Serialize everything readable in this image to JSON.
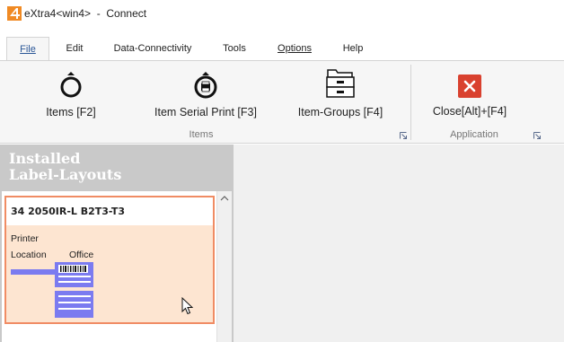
{
  "window": {
    "title": "eXtra4<win4>  -  Connect"
  },
  "menu": {
    "tabs": [
      {
        "label": "File",
        "active": true
      },
      {
        "label": "Edit",
        "active": false
      },
      {
        "label": "Data-Connectivity",
        "active": false
      },
      {
        "label": "Tools",
        "active": false
      },
      {
        "label": "Options",
        "active": false
      },
      {
        "label": "Help",
        "active": false
      }
    ]
  },
  "ribbon": {
    "buttons": [
      {
        "label": "Items [F2]",
        "icon": "ring-icon"
      },
      {
        "label": "Item Serial Print [F3]",
        "icon": "printer-ring-icon"
      },
      {
        "label": "Item-Groups [F4]",
        "icon": "folder-cabinet-icon"
      },
      {
        "label": "Close[Alt]+[F4]",
        "icon": "close-icon"
      }
    ],
    "groups": [
      {
        "label": "Items"
      },
      {
        "label": "Application"
      }
    ]
  },
  "panel": {
    "title_line1": "Installed",
    "title_line2": "Label-Layouts",
    "cards": [
      {
        "name": "34 2050IR-L B2T3-T3",
        "printer_label": "Printer",
        "location_label": "Location",
        "location_value": "Office"
      }
    ]
  },
  "colors": {
    "accent": "#2b5797",
    "card_border": "#f08c64",
    "card_fill": "#fde5d1",
    "label_icon": "#7b7bf0",
    "close_red": "#d9412f"
  }
}
